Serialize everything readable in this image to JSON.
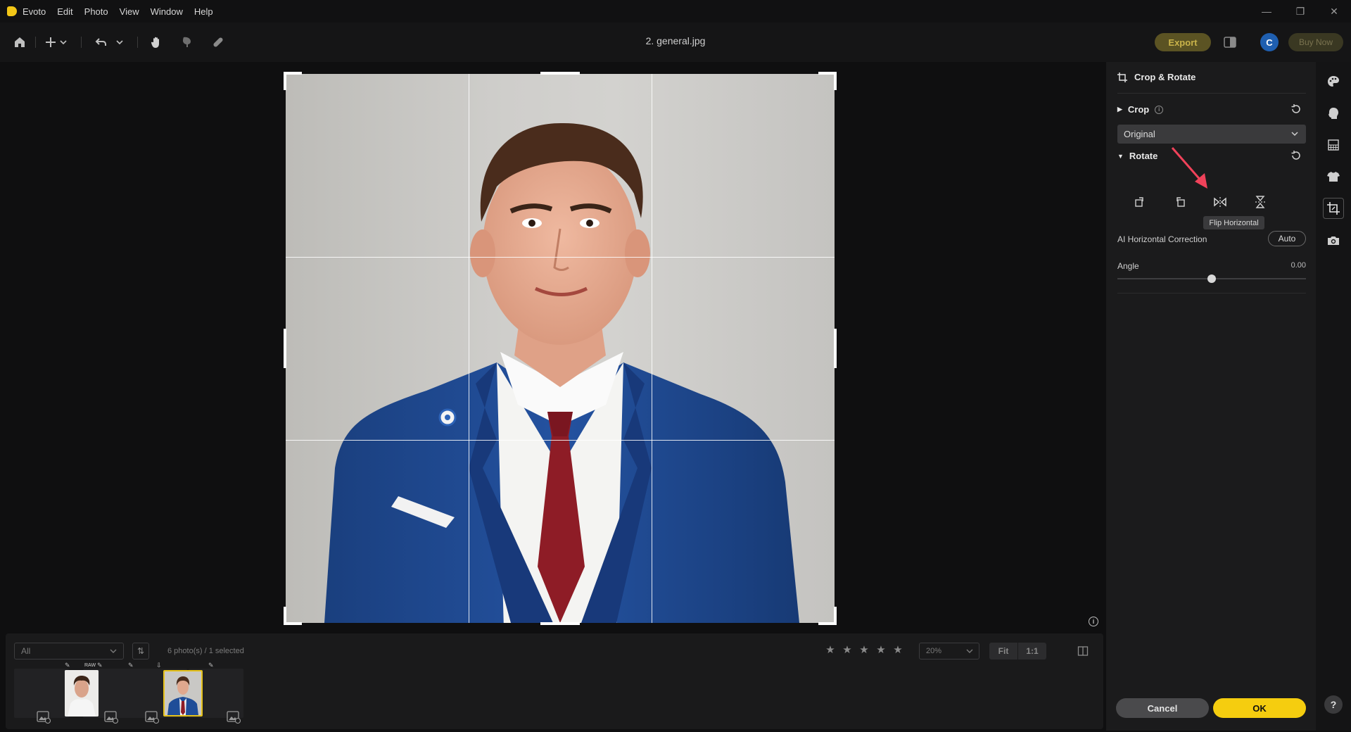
{
  "app": {
    "name": "Evoto",
    "menu": [
      "Edit",
      "Photo",
      "View",
      "Window",
      "Help"
    ]
  },
  "toolbar": {
    "document_title": "2. general.jpg",
    "export_label": "Export",
    "avatar_letter": "C",
    "buy_label": "Buy Now"
  },
  "panel": {
    "title": "Crop & Rotate",
    "crop": {
      "label": "Crop",
      "aspect_value": "Original"
    },
    "rotate": {
      "label": "Rotate",
      "tooltip": "Flip Horizontal",
      "ai_horizontal_label": "AI Horizontal Correction",
      "auto_label": "Auto",
      "angle_label": "Angle",
      "angle_value": "0.00",
      "angle_fraction": 0.5
    },
    "cancel_label": "Cancel",
    "ok_label": "OK"
  },
  "rail": {
    "help_label": "?"
  },
  "filmstrip": {
    "filter_value": "All",
    "count_text": "6 photo(s) / 1 selected",
    "zoom_value": "20%",
    "fit_label": "Fit",
    "one_to_one_label": "1:1",
    "raw_label": "RAW"
  },
  "colors": {
    "accent_yellow": "#f5cd0f",
    "annotation_arrow": "#f0425a",
    "suit_blue": "#1c4a92",
    "tie_red": "#8e1c26"
  }
}
